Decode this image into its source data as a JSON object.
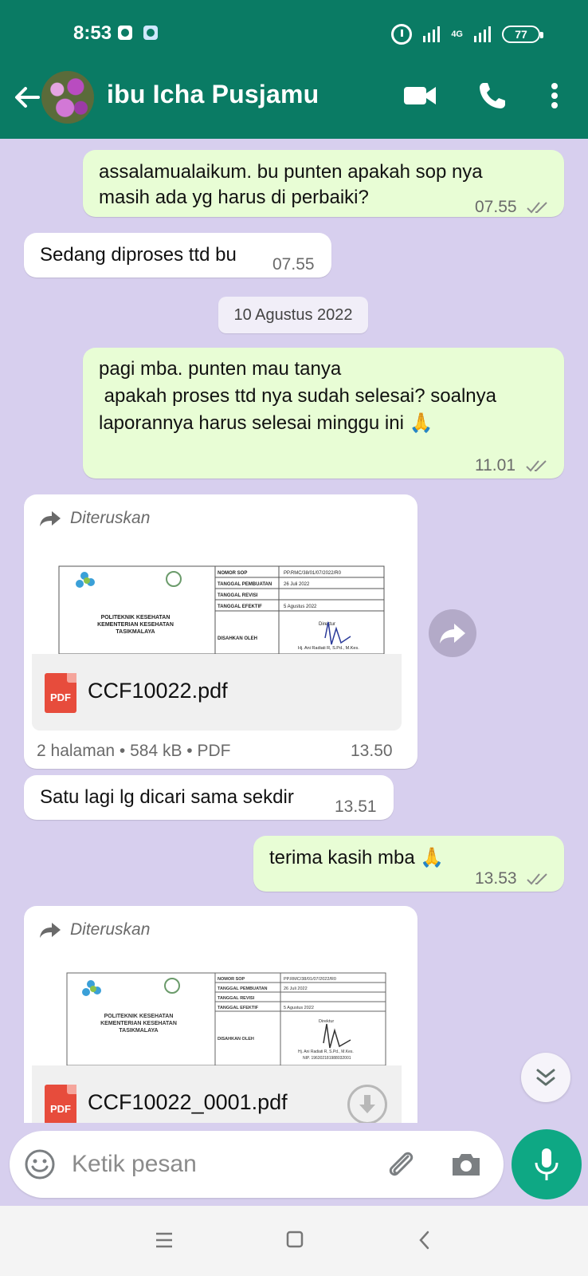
{
  "status_bar": {
    "time": "8:53",
    "network": "4G",
    "battery": "77"
  },
  "header": {
    "contact_name": "ibu Icha Pusjamu",
    "icons": [
      "back-arrow-icon",
      "video-call-icon",
      "phone-call-icon",
      "more-options-icon"
    ]
  },
  "messages": [
    {
      "direction": "outgoing",
      "text": "assalamualaikum. bu punten apakah sop nya\nmasih ada yg harus di perbaiki?",
      "time": "07.55",
      "status": "read"
    },
    {
      "direction": "incoming",
      "text": "Sedang diproses ttd bu",
      "time": "07.55"
    },
    {
      "direction": "outgoing",
      "text": "pagi mba. punten mau tanya\n apakah proses ttd nya sudah selesai? soalnya\nlaporannya harus selesai minggu ini 🙏",
      "time": "11.01",
      "status": "read"
    },
    {
      "direction": "incoming",
      "forwarded_label": "Diteruskan",
      "file_name": "CCF10022.pdf",
      "file_info": "2 halaman • 584 kB • PDF",
      "time": "13.50"
    },
    {
      "direction": "incoming",
      "text": "Satu lagi lg dicari sama sekdir",
      "time": "13.51"
    },
    {
      "direction": "outgoing",
      "text": "terima kasih mba 🙏",
      "time": "13.53",
      "status": "read"
    },
    {
      "direction": "incoming",
      "forwarded_label": "Diteruskan",
      "file_name": "CCF10022_0001.pdf"
    }
  ],
  "date_separator": "10 Agustus 2022",
  "document_preview": {
    "institution": [
      "POLITEKNIK KESEHATAN",
      "KEMENTERIAN KESEHATAN",
      "TASIKMALAYA"
    ],
    "rows": [
      {
        "label": "NOMOR SOP",
        "value": "PP.RMC/38/01/07/2022/R0"
      },
      {
        "label": "TANGGAL PEMBUATAN",
        "value": "26 Juli 2022"
      },
      {
        "label": "TANGGAL REVISI",
        "value": ""
      },
      {
        "label": "TANGGAL EFEKTIF",
        "value": "5 Agustus 2022"
      },
      {
        "label": "DISAHKAN OLEH",
        "value": "Direktur"
      }
    ],
    "signer": "Hj. Ani Radiati R, S.Pd., M.Kes."
  },
  "document_preview_2": {
    "institution": [
      "POLITEKNIK KESEHATAN",
      "KEMENTERIAN KESEHATAN",
      "TASIKMALAYA"
    ],
    "rows": [
      {
        "label": "NOMOR SOP",
        "value": "PP.RMC/38/01/07/2022/R0"
      },
      {
        "label": "TANGGAL PEMBUATAN",
        "value": "26 Juli 2022"
      },
      {
        "label": "TANGGAL REVISI",
        "value": ""
      },
      {
        "label": "TANGGAL EFEKTIF",
        "value": "5 Agustus 2022"
      },
      {
        "label": "DISAHKAN OLEH",
        "value": "Direktur"
      }
    ],
    "signer": "Hj. Ani Radiati R, S.Pd., M.Kes.",
    "nip": "NIP. 196302181988032001"
  },
  "input": {
    "placeholder": "Ketik pesan"
  },
  "pdf_badge": "PDF",
  "colors": {
    "header": "#0a7b64",
    "chat_background": "#d7cfee",
    "outgoing_bubble": "#e8fdd5",
    "incoming_bubble": "#ffffff",
    "mic_button": "#0ea884"
  }
}
